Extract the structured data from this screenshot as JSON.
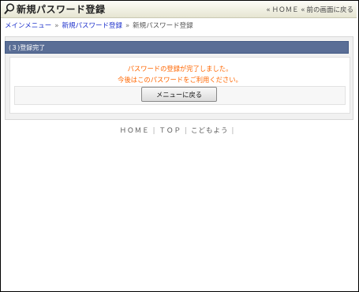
{
  "header": {
    "title": "新規パスワード登録",
    "home_link": "ＨＯＭＥ",
    "back_link": "前の画面に戻る",
    "separator": "«"
  },
  "breadcrumb": {
    "items": [
      "メインメニュー",
      "新規パスワード登録",
      "新規パスワード登録"
    ],
    "separator": "»"
  },
  "section": {
    "title": "(３)登録完了"
  },
  "message": {
    "line1": "パスワードの登録が完了しました。",
    "line2": "今後はこのパスワードをご利用ください。"
  },
  "button": {
    "label": "メニューに戻る"
  },
  "footer": {
    "links": [
      "ＨＯＭＥ",
      "ＴＯＰ",
      "こどもよう"
    ],
    "separator": "|"
  },
  "colors": {
    "section_bar": "#5a6e96",
    "message_text": "#ff6600",
    "link": "#1f33cc"
  }
}
